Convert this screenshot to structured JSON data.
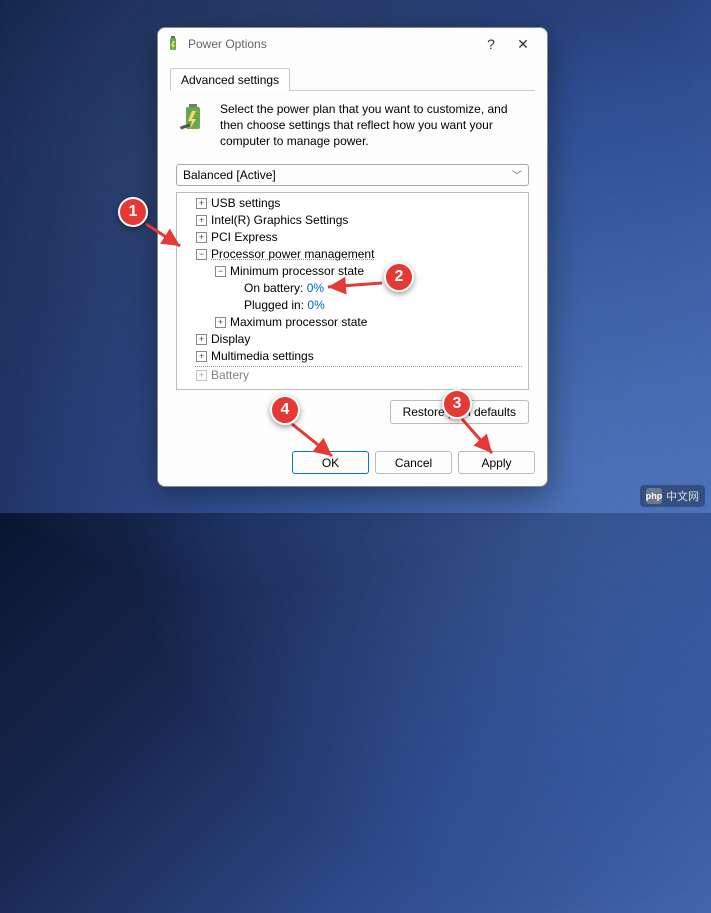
{
  "window": {
    "title": "Power Options",
    "help_glyph": "?",
    "close_glyph": "✕"
  },
  "tab": {
    "label": "Advanced settings"
  },
  "description": "Select the power plan that you want to customize, and then choose settings that reflect how you want your computer to manage power.",
  "plan": {
    "selected": "Balanced [Active]"
  },
  "tree": {
    "items": [
      {
        "label": "USB settings",
        "expander": "+",
        "level": 1
      },
      {
        "label": "Intel(R) Graphics Settings",
        "expander": "+",
        "level": 1
      },
      {
        "label": "PCI Express",
        "expander": "+",
        "level": 1
      },
      {
        "label": "Processor power management",
        "expander": "−",
        "level": 1,
        "selected": true
      },
      {
        "label": "Minimum processor state",
        "expander": "−",
        "level": 2
      },
      {
        "label_prefix": "On battery:",
        "value": "0%",
        "level": 3
      },
      {
        "label_prefix": "Plugged in:",
        "value": "0%",
        "level": 3
      },
      {
        "label": "Maximum processor state",
        "expander": "+",
        "level": 2
      },
      {
        "label": "Display",
        "expander": "+",
        "level": 1
      },
      {
        "label": "Multimedia settings",
        "expander": "+",
        "level": 1
      },
      {
        "label": "Battery",
        "expander": "+",
        "level": 1
      }
    ]
  },
  "buttons": {
    "restore": "Restore plan defaults",
    "ok": "OK",
    "cancel": "Cancel",
    "apply": "Apply"
  },
  "annotations": {
    "badge1": "1",
    "badge2": "2",
    "badge3": "3",
    "badge4": "4"
  },
  "watermark": {
    "text": "中文网",
    "prefix": "php"
  },
  "colors": {
    "badge": "#e53935",
    "link": "#0066cc"
  }
}
